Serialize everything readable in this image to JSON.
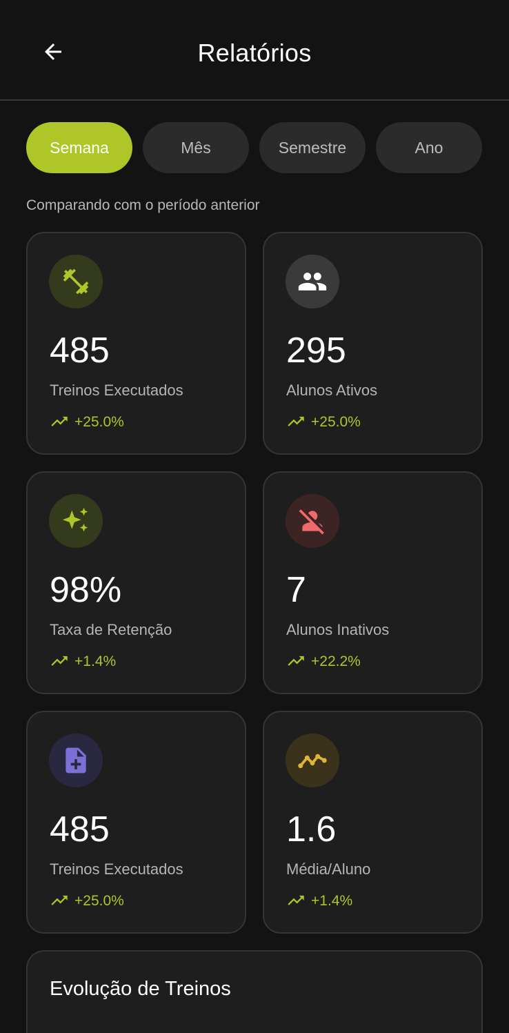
{
  "header": {
    "title": "Relatórios"
  },
  "tabs": [
    {
      "label": "Semana",
      "active": true
    },
    {
      "label": "Mês",
      "active": false
    },
    {
      "label": "Semestre",
      "active": false
    },
    {
      "label": "Ano",
      "active": false
    }
  ],
  "subtitle": "Comparando com o período anterior",
  "cards": [
    {
      "icon": "dumbbell-icon",
      "value": "485",
      "label": "Treinos Executados",
      "trend": "+25.0%",
      "accent": "#aec627"
    },
    {
      "icon": "people-icon",
      "value": "295",
      "label": "Alunos Ativos",
      "trend": "+25.0%",
      "accent": "#ffffff"
    },
    {
      "icon": "sparkles-icon",
      "value": "98%",
      "label": "Taxa de Retenção",
      "trend": "+1.4%",
      "accent": "#aec627"
    },
    {
      "icon": "person-off-icon",
      "value": "7",
      "label": "Alunos Inativos",
      "trend": "+22.2%",
      "accent": "#ef6a6a"
    },
    {
      "icon": "note-add-icon",
      "value": "485",
      "label": "Treinos Executados",
      "trend": "+25.0%",
      "accent": "#7e6fd6"
    },
    {
      "icon": "line-chart-icon",
      "value": "1.6",
      "label": "Média/Aluno",
      "trend": "+1.4%",
      "accent": "#e0b43a"
    }
  ],
  "section": {
    "title": "Evolução de Treinos"
  },
  "colors": {
    "background": "#131313",
    "card": "#1e1e1e",
    "accent": "#aec627",
    "tab_inactive": "#2b2b2b"
  }
}
